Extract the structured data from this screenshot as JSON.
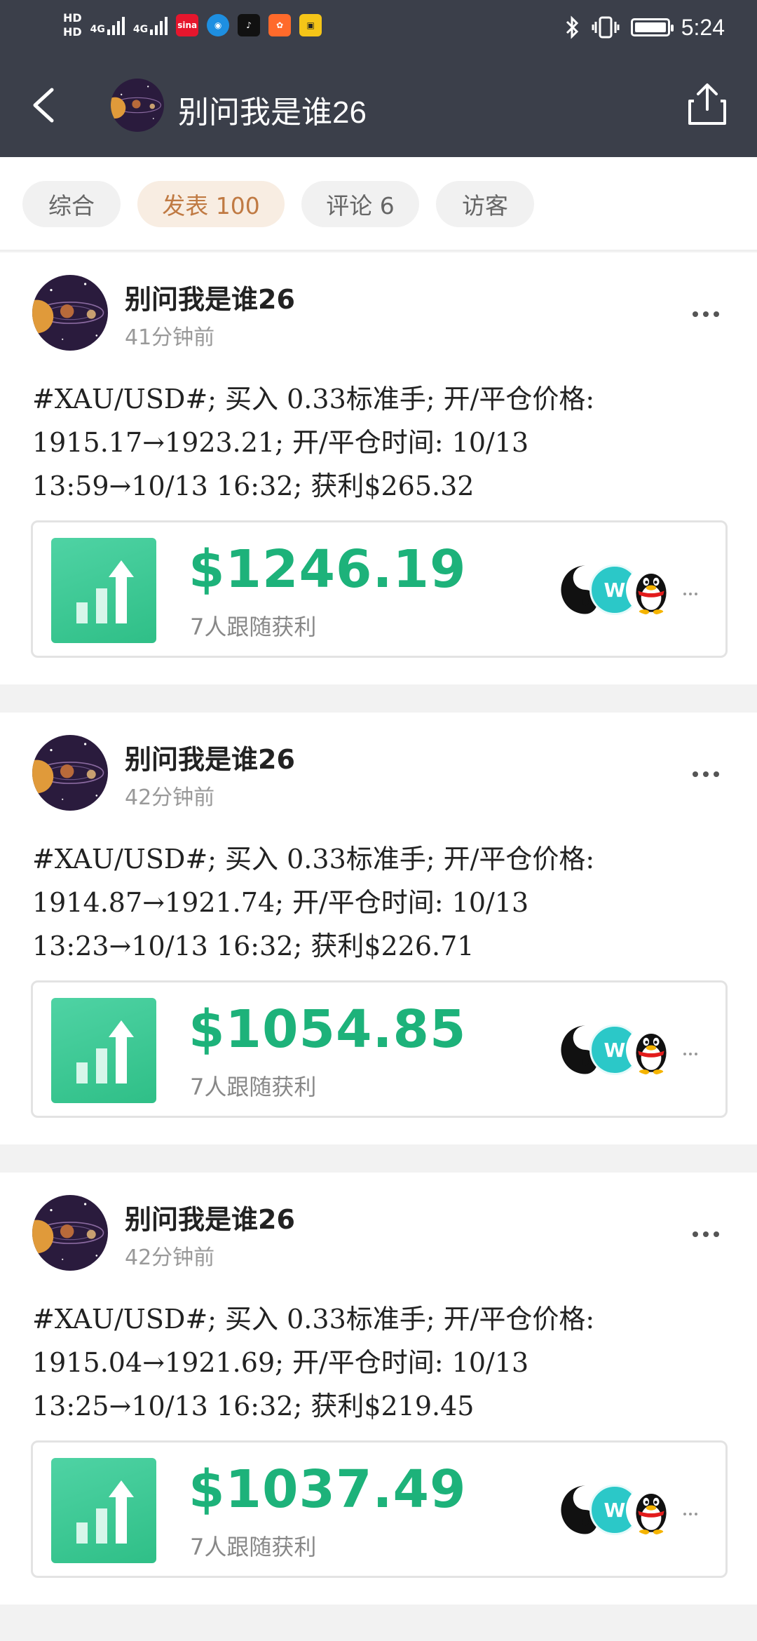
{
  "status_bar": {
    "hd1": "HD",
    "hd2": "HD",
    "net1": "4G",
    "net2": "4G",
    "app_sina": "sina",
    "time": "5:24"
  },
  "nav": {
    "title": "别问我是谁26"
  },
  "tabs": [
    {
      "label": "综合",
      "active": false
    },
    {
      "label": "发表 100",
      "active": true
    },
    {
      "label": "评论 6",
      "active": false
    },
    {
      "label": "访客",
      "active": false
    }
  ],
  "posts": [
    {
      "author": "别问我是谁26",
      "time": "41分钟前",
      "line1": "#XAU/USD#; 买入 0.33标准手; 开/平仓价格:",
      "line2": "1915.17→1923.21; 开/平仓时间:  10/13",
      "line3": "13:59→10/13 16:32; 获利$265.32",
      "amount": "$1246.19",
      "followers": "7人跟随获利"
    },
    {
      "author": "别问我是谁26",
      "time": "42分钟前",
      "line1": "#XAU/USD#; 买入 0.33标准手; 开/平仓价格:",
      "line2": "1914.87→1921.74; 开/平仓时间:  10/13",
      "line3": "13:23→10/13 16:32; 获利$226.71",
      "amount": "$1054.85",
      "followers": "7人跟随获利"
    },
    {
      "author": "别问我是谁26",
      "time": "42分钟前",
      "line1": "#XAU/USD#; 买入 0.33标准手; 开/平仓价格:",
      "line2": "1915.04→1921.69; 开/平仓时间:  10/13",
      "line3": "13:25→10/13 16:32; 获利$219.45",
      "amount": "$1037.49",
      "followers": "7人跟随获利"
    }
  ],
  "follower_avatar_letter": "W",
  "colors": {
    "header_bg": "#3b3f4a",
    "accent_green": "#1db27a",
    "tab_active_text": "#c07a43",
    "tab_active_bg": "#f8ede2"
  }
}
